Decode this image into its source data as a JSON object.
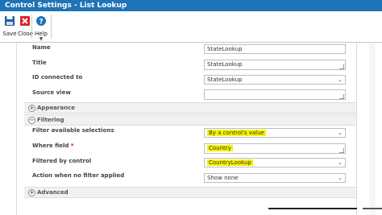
{
  "window": {
    "title": "Control Settings - List Lookup"
  },
  "ribbon": {
    "save_label": "Save",
    "close_label": "Close",
    "help_label": "Help",
    "colors": {
      "save": "#1f5fa8",
      "close": "#d9232d",
      "help": "#1f73b7"
    }
  },
  "fields": {
    "name": {
      "label": "Name",
      "value": "StateLookup"
    },
    "title": {
      "label": "Title",
      "value": "StateLookup"
    },
    "id_connected": {
      "label": "ID connected to",
      "value": "StateLookup"
    },
    "source_view": {
      "label": "Source view",
      "value": ""
    }
  },
  "sections": {
    "appearance": {
      "label": "Appearance",
      "toggle": "+"
    },
    "filtering": {
      "label": "Filtering",
      "toggle": "−"
    },
    "advanced": {
      "label": "Advanced",
      "toggle": "+"
    }
  },
  "filtering": {
    "filter_available": {
      "label": "Filter available selections",
      "value": "By a control's value"
    },
    "where_field": {
      "label": "Where field",
      "required_mark": "*",
      "value": "Country"
    },
    "filtered_by": {
      "label": "Filtered by control",
      "value": "CountryLookup"
    },
    "action_no_filter": {
      "label": "Action when no filter applied",
      "value": "Show none"
    }
  },
  "highlight_color": "#f7f300"
}
